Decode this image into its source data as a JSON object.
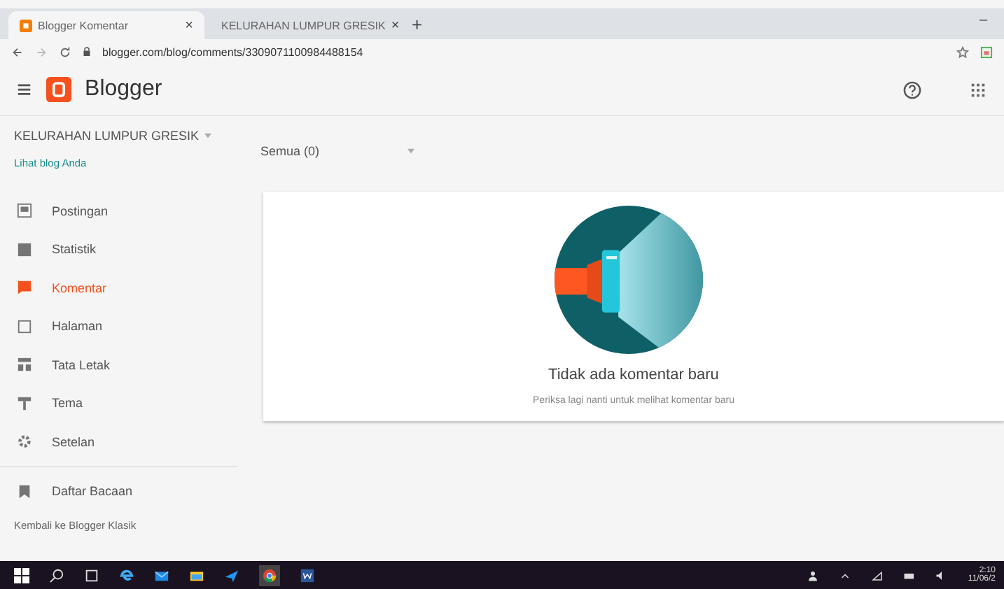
{
  "browser": {
    "tabs": [
      {
        "title": "Blogger Komentar",
        "close": "×",
        "selected": true
      },
      {
        "title": "KELURAHAN LUMPUR GRESIK",
        "close": "×",
        "selected": false
      }
    ],
    "new_tab": "+",
    "minimize": "–",
    "url": "blogger.com/blog/comments/3309071100984488154"
  },
  "header": {
    "menu": "≡",
    "brand": "Blogger"
  },
  "sidebar": {
    "blog_name": "KELURAHAN LUMPUR GRESIK",
    "view_blog": "Lihat blog Anda",
    "items": [
      {
        "label": "Postingan",
        "kind": "posts",
        "selected": false
      },
      {
        "label": "Statistik",
        "kind": "stats",
        "selected": false
      },
      {
        "label": "Komentar",
        "kind": "comments",
        "selected": true
      },
      {
        "label": "Halaman",
        "kind": "pages",
        "selected": false
      },
      {
        "label": "Tata Letak",
        "kind": "layout",
        "selected": false
      },
      {
        "label": "Tema",
        "kind": "theme",
        "selected": false
      },
      {
        "label": "Setelan",
        "kind": "settings",
        "selected": false
      }
    ],
    "reading_list": "Daftar Bacaan",
    "classic_link": "Kembali ke Blogger Klasik"
  },
  "filter": {
    "value": "Semua (0)"
  },
  "empty_state": {
    "title": "Tidak ada komentar baru",
    "subtitle": "Periksa lagi nanti untuk melihat komentar baru"
  },
  "taskbar": {
    "time": "2:10",
    "date": "11/06/2"
  }
}
